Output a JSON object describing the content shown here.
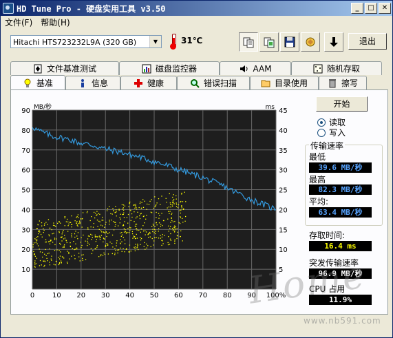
{
  "window": {
    "title": "HD Tune Pro - 硬盘实用工具 v3.50"
  },
  "menu": {
    "items": [
      "文件(F)",
      "帮助(H)"
    ]
  },
  "toolbar": {
    "drive": "Hitachi HTS723232L9A (320 GB)",
    "temperature": "31℃",
    "exit_label": "退出"
  },
  "tabs": {
    "top": [
      {
        "label": "文件基准测试",
        "icon": "file-benchmark-icon"
      },
      {
        "label": "磁盘监控器",
        "icon": "disk-monitor-icon"
      },
      {
        "label": "AAM",
        "icon": "speaker-icon"
      },
      {
        "label": "随机存取",
        "icon": "random-access-icon"
      }
    ],
    "bottom": [
      {
        "label": "基准",
        "icon": "bulb-icon"
      },
      {
        "label": "信息",
        "icon": "info-icon"
      },
      {
        "label": "健康",
        "icon": "health-cross-icon"
      },
      {
        "label": "错误扫描",
        "icon": "magnifier-icon"
      },
      {
        "label": "目录使用",
        "icon": "folder-icon"
      },
      {
        "label": "擦写",
        "icon": "trash-icon"
      }
    ]
  },
  "controls": {
    "start_label": "开始",
    "read_label": "读取",
    "write_label": "写入",
    "mode_selected": "read"
  },
  "stats": {
    "transfer_title": "传输速率",
    "min_label": "最低",
    "min_value": "39.6 MB/秒",
    "max_label": "最高",
    "max_value": "82.3 MB/秒",
    "avg_label": "平均:",
    "avg_value": "63.4 MB/秒",
    "access_label": "存取时间:",
    "access_value": "16.4 ms",
    "burst_label": "突发传输速率",
    "burst_value": "96.9 MB/秒",
    "cpu_label": "CPU 占用",
    "cpu_value": "11.9%"
  },
  "watermark": {
    "url": "www.nb591.com",
    "script": "Home"
  },
  "chart_data": {
    "type": "line",
    "left_axis_label": "MB/秒",
    "right_axis_label": "ms",
    "xlim": [
      0,
      100
    ],
    "ylim_left": [
      0,
      90
    ],
    "ylim_right": [
      0,
      45
    ],
    "x_ticks": [
      "0",
      "10",
      "20",
      "30",
      "40",
      "50",
      "60",
      "70",
      "80",
      "90",
      "100%"
    ],
    "y_ticks_left": [
      "90",
      "80",
      "70",
      "60",
      "50",
      "40",
      "30",
      "20",
      "10"
    ],
    "y_ticks_right": [
      "45",
      "40",
      "35",
      "30",
      "25",
      "20",
      "15",
      "10",
      "5"
    ],
    "grid": true,
    "series": [
      {
        "kind": "transfer",
        "color": "#3399dd",
        "x": [
          0,
          2,
          4,
          6,
          8,
          10,
          12,
          14,
          16,
          18,
          20,
          22,
          24,
          26,
          28,
          30,
          32,
          34,
          36,
          38,
          40,
          42,
          44,
          46,
          48,
          50,
          52,
          54,
          56,
          58,
          60,
          62,
          64,
          66,
          68,
          70,
          72,
          74,
          76,
          78,
          80,
          82,
          84,
          86,
          88,
          90,
          92,
          94,
          96,
          98,
          100
        ],
        "y": [
          82,
          80,
          79,
          78,
          77,
          76.5,
          76,
          75.5,
          75,
          74,
          73.5,
          73,
          72.5,
          72,
          71,
          70.5,
          70,
          69.5,
          69,
          68.5,
          67.5,
          67,
          66.5,
          65.5,
          65,
          64,
          63.5,
          62.5,
          62,
          61,
          60,
          59.5,
          58.5,
          57.5,
          57,
          56,
          55,
          54,
          53,
          52,
          51,
          49.5,
          48.5,
          47.5,
          46,
          45,
          44,
          43,
          42,
          41,
          40
        ]
      },
      {
        "kind": "access",
        "color": "#ffff00",
        "x_range": [
          0,
          63
        ],
        "y_bottom_start": 5,
        "y_bottom_end": 12,
        "y_top_start": 17,
        "y_top_end": 25
      }
    ]
  }
}
